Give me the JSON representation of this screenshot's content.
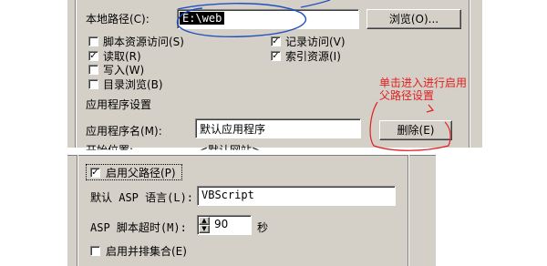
{
  "top": {
    "local_path_label": "本地路径(C):",
    "local_path_value": "E:\\web",
    "browse_button": "浏览(O)...",
    "checkboxes": [
      {
        "label": "脚本资源访问(S)",
        "checked": false
      },
      {
        "label": "读取(R)",
        "checked": true
      },
      {
        "label": "写入(W)",
        "checked": false
      },
      {
        "label": "目录浏览(B)",
        "checked": false
      },
      {
        "label": "记录访问(V)",
        "checked": true
      },
      {
        "label": "索引资源(I)",
        "checked": true
      }
    ],
    "app_settings_heading": "应用程序设置",
    "app_name_label": "应用程序名(M):",
    "app_name_value": "默认应用程序",
    "remove_button": "删除(E)",
    "annotation_text": "单击进入进行启用父路径设置",
    "start_position_label": "开始位置:",
    "start_position_value": "<默认网站>"
  },
  "bottom": {
    "enable_parent_paths": {
      "label": "启用父路径(P)",
      "checked": true
    },
    "default_asp_language_label": "默认 ASP 语言(L):",
    "default_asp_language_value": "VBScript",
    "asp_timeout_label": "ASP 脚本超时(M):",
    "asp_timeout_value": "90",
    "asp_timeout_unit": "秒",
    "enable_side_by_side": {
      "label": "启用并排集合(E)",
      "checked": false
    }
  },
  "colors": {
    "annotation": "#e02020",
    "circle": "#2050c0"
  }
}
